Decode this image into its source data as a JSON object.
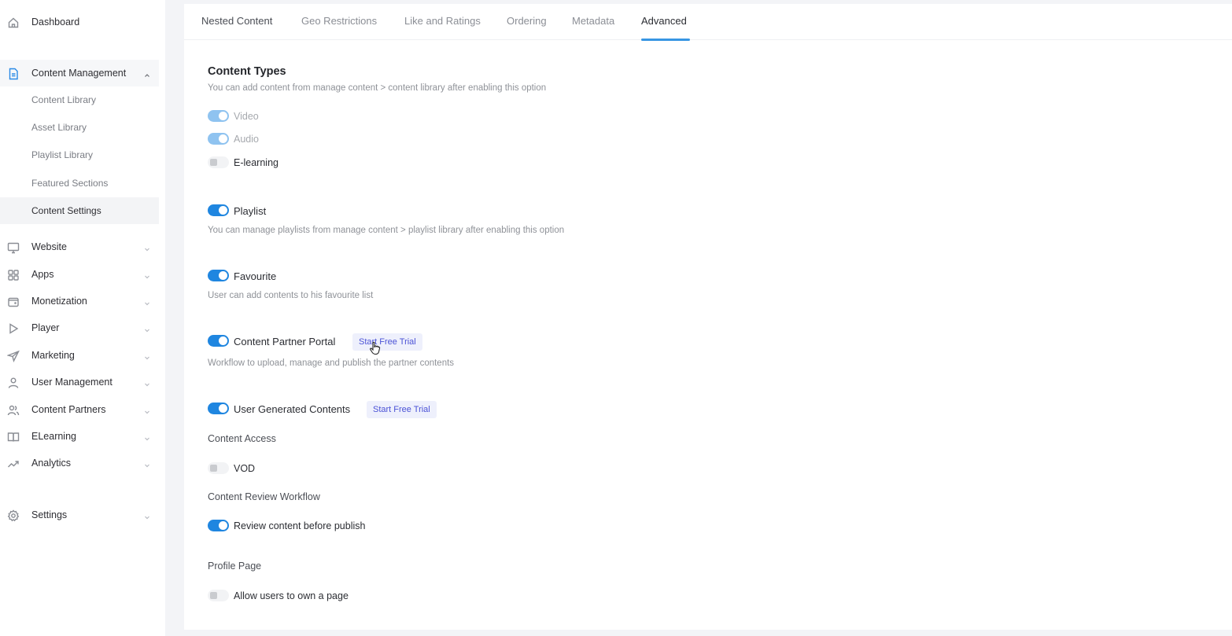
{
  "sidebar": {
    "dashboard": {
      "label": "Dashboard",
      "icon": "home-icon"
    },
    "content_management": {
      "label": "Content Management",
      "icon": "document-icon",
      "expanded": true,
      "children": [
        {
          "label": "Content Library"
        },
        {
          "label": "Asset Library"
        },
        {
          "label": "Playlist Library"
        },
        {
          "label": "Featured Sections"
        },
        {
          "label": "Content Settings",
          "active": true
        }
      ]
    },
    "groups": [
      {
        "label": "Website",
        "icon": "monitor-icon"
      },
      {
        "label": "Apps",
        "icon": "grid-icon"
      },
      {
        "label": "Monetization",
        "icon": "wallet-icon"
      },
      {
        "label": "Player",
        "icon": "play-icon"
      },
      {
        "label": "Marketing",
        "icon": "send-icon"
      },
      {
        "label": "User Management",
        "icon": "user-icon"
      },
      {
        "label": "Content Partners",
        "icon": "users-icon"
      },
      {
        "label": "ELearning",
        "icon": "book-icon"
      },
      {
        "label": "Analytics",
        "icon": "trend-icon"
      }
    ],
    "settings": {
      "label": "Settings",
      "icon": "gear-icon"
    }
  },
  "tabs": [
    {
      "label": "Nested Content"
    },
    {
      "label": "Geo Restrictions"
    },
    {
      "label": "Like and Ratings"
    },
    {
      "label": "Ordering"
    },
    {
      "label": "Metadata"
    },
    {
      "label": "Advanced",
      "active": true
    }
  ],
  "content": {
    "content_types": {
      "title": "Content Types",
      "description": "You can add content from manage content > content library after enabling this option",
      "options": [
        {
          "label": "Video",
          "enabled": true,
          "disabled": true
        },
        {
          "label": "Audio",
          "enabled": true,
          "disabled": true
        },
        {
          "label": "E-learning",
          "enabled": false,
          "disabled": false
        }
      ]
    },
    "playlist": {
      "label": "Playlist",
      "enabled": true,
      "description": "You can manage playlists from manage content > playlist library after enabling this option"
    },
    "favourite": {
      "label": "Favourite",
      "enabled": true,
      "description": "User can add contents to his favourite list"
    },
    "content_partner_portal": {
      "label": "Content Partner Portal",
      "enabled": true,
      "trial_button": "Start Free Trial",
      "description": "Workflow to upload, manage and publish the partner contents"
    },
    "user_generated_contents": {
      "label": "User Generated Contents",
      "enabled": true,
      "trial_button": "Start Free Trial",
      "content_access": {
        "heading": "Content Access",
        "options": [
          {
            "label": "VOD",
            "enabled": false
          }
        ]
      },
      "review_workflow": {
        "heading": "Content Review Workflow",
        "options": [
          {
            "label": "Review content before publish",
            "enabled": true
          }
        ]
      }
    },
    "profile_page": {
      "heading": "Profile Page",
      "options": [
        {
          "label": "Allow users to own a page",
          "enabled": false
        }
      ]
    }
  },
  "colors": {
    "accent": "#1f86e0",
    "tab_underline": "#3896e3",
    "trial_text": "#4b52d6",
    "trial_bg": "#eef0fc"
  }
}
